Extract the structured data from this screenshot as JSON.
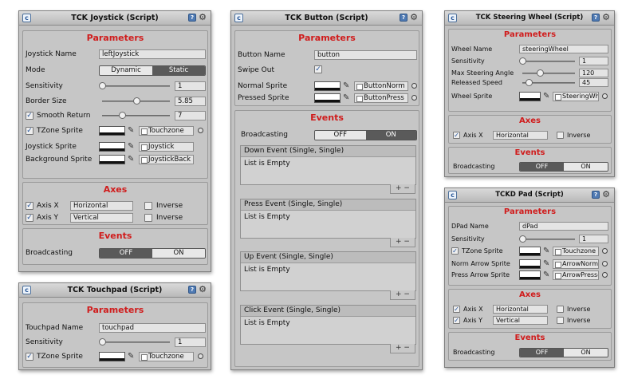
{
  "joystick": {
    "title": "TCK Joystick (Script)",
    "params_header": "Parameters",
    "name_label": "Joystick Name",
    "name_value": "leftJoystick",
    "mode_label": "Mode",
    "mode_options": [
      "Dynamic",
      "Static"
    ],
    "mode_selected": "Static",
    "sensitivity_label": "Sensitivity",
    "sensitivity_value": "1",
    "sensitivity_fraction": 0.0,
    "border_label": "Border Size",
    "border_value": "5.85",
    "border_fraction": 0.5,
    "smooth_label": "Smooth Return",
    "smooth_value": "7",
    "smooth_checked": true,
    "smooth_fraction": 0.29,
    "tzone_label": "TZone Sprite",
    "tzone_value": "Touchzone",
    "tzone_checked": true,
    "joystick_sprite_label": "Joystick Sprite",
    "joystick_sprite_value": "Joystick",
    "bg_sprite_label": "Background Sprite",
    "bg_sprite_value": "JoystickBack",
    "axes_header": "Axes",
    "axis_x_label": "Axis X",
    "axis_x_value": "Horizontal",
    "axis_x_inverse": "Inverse",
    "axis_y_label": "Axis Y",
    "axis_y_value": "Vertical",
    "axis_y_inverse": "Inverse",
    "events_header": "Events",
    "broadcasting_label": "Broadcasting",
    "off_label": "OFF",
    "on_label": "ON",
    "broadcasting": "OFF"
  },
  "touchpad": {
    "title": "TCK Touchpad (Script)",
    "params_header": "Parameters",
    "name_label": "Touchpad Name",
    "name_value": "touchpad",
    "sensitivity_label": "Sensitivity",
    "sensitivity_value": "1",
    "sensitivity_fraction": 0.0,
    "tzone_label": "TZone Sprite",
    "tzone_value": "Touchzone",
    "tzone_checked": true
  },
  "button": {
    "title": "TCK Button (Script)",
    "params_header": "Parameters",
    "name_label": "Button Name",
    "name_value": "button",
    "swipe_label": "Swipe Out",
    "swipe_checked": true,
    "normal_label": "Normal Sprite",
    "normal_value": "ButtonNorm",
    "pressed_label": "Pressed Sprite",
    "pressed_value": "ButtonPress",
    "events_header": "Events",
    "broadcasting_label": "Broadcasting",
    "off_label": "OFF",
    "on_label": "ON",
    "broadcasting": "ON",
    "event_lists": [
      {
        "title": "Down Event (Single, Single)",
        "body": "List is Empty"
      },
      {
        "title": "Press Event (Single, Single)",
        "body": "List is Empty"
      },
      {
        "title": "Up Event (Single, Single)",
        "body": "List is Empty"
      },
      {
        "title": "Click Event (Single, Single)",
        "body": "List is Empty"
      }
    ],
    "list_controls": "+  −"
  },
  "steering": {
    "title": "TCK Steering Wheel (Script)",
    "params_header": "Parameters",
    "name_label": "Wheel Name",
    "name_value": "steeringWheel",
    "sensitivity_label": "Sensitivity",
    "sensitivity_value": "1",
    "sensitivity_fraction": 0.0,
    "max_angle_label": "Max Steering Angle",
    "max_angle_value": "120",
    "max_angle_fraction": 0.33,
    "speed_label": "Released Speed",
    "speed_value": "45",
    "speed_fraction": 0.12,
    "sprite_label": "Wheel Sprite",
    "sprite_value": "SteeringWhe",
    "axes_header": "Axes",
    "axis_x_label": "Axis X",
    "axis_x_value": "Horizontal",
    "axis_x_inverse": "Inverse",
    "events_header": "Events",
    "broadcasting_label": "Broadcasting",
    "off_label": "OFF",
    "on_label": "ON",
    "broadcasting": "OFF"
  },
  "dpad": {
    "title": "TCKD Pad (Script)",
    "params_header": "Parameters",
    "name_label": "DPad Name",
    "name_value": "dPad",
    "sensitivity_label": "Sensitivity",
    "sensitivity_value": "1",
    "sensitivity_fraction": 0.0,
    "tzone_label": "TZone Sprite",
    "tzone_value": "Touchzone",
    "tzone_checked": true,
    "norm_arrow_label": "Norm Arrow Sprite",
    "norm_arrow_value": "ArrowNorma",
    "press_arrow_label": "Press Arrow Sprite",
    "press_arrow_value": "ArrowPresse",
    "axes_header": "Axes",
    "axis_x_label": "Axis X",
    "axis_x_value": "Horizontal",
    "axis_x_inverse": "Inverse",
    "axis_y_label": "Axis Y",
    "axis_y_value": "Vertical",
    "axis_y_inverse": "Inverse",
    "events_header": "Events",
    "broadcasting_label": "Broadcasting",
    "off_label": "OFF",
    "on_label": "ON",
    "broadcasting": "OFF"
  },
  "colors": {
    "header_red": "#d01c1c",
    "panel_bg": "#c2c2c2",
    "toggle_active": "#5a5a5a"
  },
  "icons": [
    "script-icon",
    "help-icon",
    "gear-icon",
    "eyedropper-icon",
    "object-picker-icon",
    "checkmark-icon"
  ]
}
